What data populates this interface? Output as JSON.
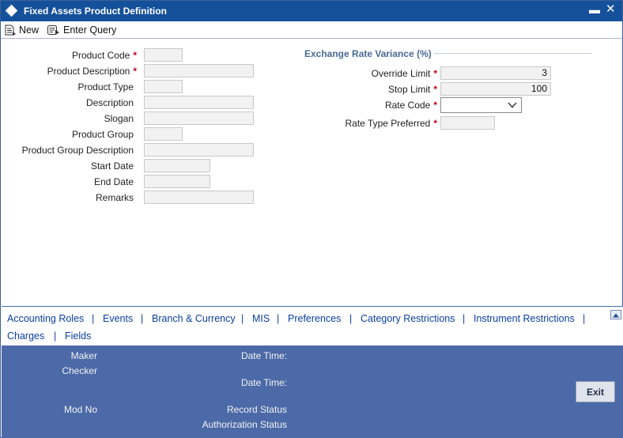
{
  "window": {
    "title": "Fixed Assets Product Definition",
    "minimize_glyph": "▬",
    "close_glyph": "✕"
  },
  "toolbar": {
    "new_label": "New",
    "enter_query_label": "Enter Query"
  },
  "form": {
    "required_mark": "*",
    "product_code_label": "Product Code",
    "product_description_label": "Product Description",
    "product_type_label": "Product Type",
    "description_label": "Description",
    "slogan_label": "Slogan",
    "product_group_label": "Product Group",
    "product_group_description_label": "Product Group Description",
    "start_date_label": "Start Date",
    "end_date_label": "End Date",
    "remarks_label": "Remarks",
    "product_code_value": "",
    "product_description_value": "",
    "product_type_value": "",
    "description_value": "",
    "slogan_value": "",
    "product_group_value": "",
    "product_group_description_value": "",
    "start_date_value": "",
    "end_date_value": "",
    "remarks_value": ""
  },
  "exchange_rate": {
    "section_title": "Exchange Rate Variance (%)",
    "override_limit_label": "Override Limit",
    "override_limit_value": "3",
    "stop_limit_label": "Stop Limit",
    "stop_limit_value": "100",
    "rate_code_label": "Rate Code",
    "rate_code_value": "",
    "rate_type_preferred_label": "Rate Type Preferred",
    "rate_type_preferred_value": ""
  },
  "tabs": {
    "items": [
      "Accounting Roles",
      "Events",
      "Branch & Currency",
      "MIS",
      "Preferences",
      "Category Restrictions",
      "Instrument Restrictions",
      "Charges",
      "Fields"
    ],
    "separator": "|"
  },
  "audit": {
    "maker_label": "Maker",
    "checker_label": "Checker",
    "date_time_label": "Date Time:",
    "mod_no_label": "Mod No",
    "record_status_label": "Record Status",
    "authorization_status_label": "Authorization Status",
    "exit_label": "Exit"
  },
  "colors": {
    "titlebar": "#15519b",
    "audit_panel": "#4c6aa8",
    "link": "#0a3fa0",
    "required": "#c0001c",
    "section_title": "#4a6a96"
  }
}
